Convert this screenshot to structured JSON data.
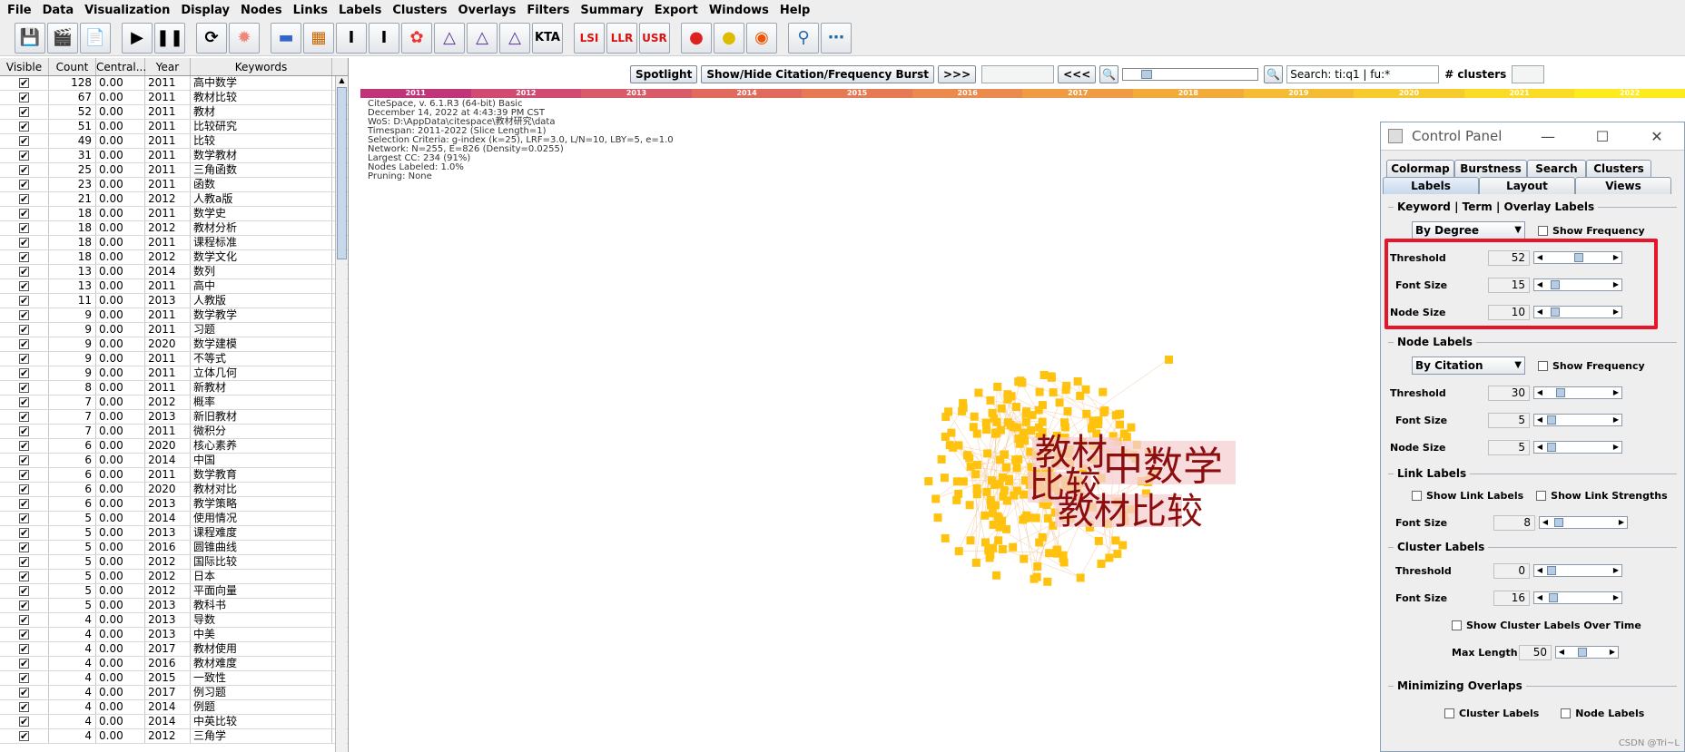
{
  "menu": [
    "File",
    "Data",
    "Visualization",
    "Display",
    "Nodes",
    "Links",
    "Labels",
    "Clusters",
    "Overlays",
    "Filters",
    "Summary",
    "Export",
    "Windows",
    "Help"
  ],
  "toolbar": {
    "lsi": "LSI",
    "llr": "LLR",
    "usr": "USR",
    "kta": "KTA"
  },
  "table": {
    "headers": [
      "Visible",
      "Count",
      "Central...",
      "Year",
      "Keywords"
    ],
    "rows": [
      [
        "128",
        "0.00",
        "2011",
        "高中数学"
      ],
      [
        "67",
        "0.00",
        "2011",
        "教材比较"
      ],
      [
        "52",
        "0.00",
        "2011",
        "教材"
      ],
      [
        "51",
        "0.00",
        "2011",
        "比较研究"
      ],
      [
        "49",
        "0.00",
        "2011",
        "比较"
      ],
      [
        "31",
        "0.00",
        "2011",
        "数学教材"
      ],
      [
        "25",
        "0.00",
        "2011",
        "三角函数"
      ],
      [
        "23",
        "0.00",
        "2011",
        "函数"
      ],
      [
        "21",
        "0.00",
        "2012",
        "人教a版"
      ],
      [
        "18",
        "0.00",
        "2011",
        "数学史"
      ],
      [
        "18",
        "0.00",
        "2012",
        "教材分析"
      ],
      [
        "18",
        "0.00",
        "2011",
        "课程标准"
      ],
      [
        "18",
        "0.00",
        "2012",
        "数学文化"
      ],
      [
        "13",
        "0.00",
        "2014",
        "数列"
      ],
      [
        "13",
        "0.00",
        "2011",
        "高中"
      ],
      [
        "11",
        "0.00",
        "2013",
        "人教版"
      ],
      [
        "9",
        "0.00",
        "2011",
        "数学教学"
      ],
      [
        "9",
        "0.00",
        "2011",
        "习题"
      ],
      [
        "9",
        "0.00",
        "2020",
        "数学建模"
      ],
      [
        "9",
        "0.00",
        "2011",
        "不等式"
      ],
      [
        "9",
        "0.00",
        "2011",
        "立体几何"
      ],
      [
        "8",
        "0.00",
        "2011",
        "新教材"
      ],
      [
        "7",
        "0.00",
        "2012",
        "概率"
      ],
      [
        "7",
        "0.00",
        "2013",
        "新旧教材"
      ],
      [
        "7",
        "0.00",
        "2011",
        "微积分"
      ],
      [
        "6",
        "0.00",
        "2020",
        "核心素养"
      ],
      [
        "6",
        "0.00",
        "2014",
        "中国"
      ],
      [
        "6",
        "0.00",
        "2011",
        "数学教育"
      ],
      [
        "6",
        "0.00",
        "2020",
        "教材对比"
      ],
      [
        "6",
        "0.00",
        "2013",
        "教学策略"
      ],
      [
        "5",
        "0.00",
        "2014",
        "使用情况"
      ],
      [
        "5",
        "0.00",
        "2013",
        "课程难度"
      ],
      [
        "5",
        "0.00",
        "2016",
        "圆锥曲线"
      ],
      [
        "5",
        "0.00",
        "2012",
        "国际比较"
      ],
      [
        "5",
        "0.00",
        "2012",
        "日本"
      ],
      [
        "5",
        "0.00",
        "2012",
        "平面向量"
      ],
      [
        "5",
        "0.00",
        "2013",
        "教科书"
      ],
      [
        "4",
        "0.00",
        "2013",
        "导数"
      ],
      [
        "4",
        "0.00",
        "2013",
        "中美"
      ],
      [
        "4",
        "0.00",
        "2017",
        "教材使用"
      ],
      [
        "4",
        "0.00",
        "2016",
        "教材难度"
      ],
      [
        "4",
        "0.00",
        "2015",
        "一致性"
      ],
      [
        "4",
        "0.00",
        "2017",
        "例习题"
      ],
      [
        "4",
        "0.00",
        "2014",
        "例题"
      ],
      [
        "4",
        "0.00",
        "2014",
        "中英比较"
      ],
      [
        "4",
        "0.00",
        "2012",
        "三角学"
      ]
    ]
  },
  "controls": {
    "spotlight": "Spotlight",
    "show_hide": "Show/Hide Citation/Frequency Burst",
    "next": ">>>",
    "prev": "<<<",
    "search_value": "Search: ti:q1 | fu:*",
    "clusters_label": "# clusters"
  },
  "timeline": {
    "years": [
      "2011",
      "2012",
      "2013",
      "2014",
      "2015",
      "2016",
      "2017",
      "2018",
      "2019",
      "2020",
      "2021",
      "2022"
    ],
    "colors": [
      "#c0357a",
      "#d04a72",
      "#d95b68",
      "#e06a5e",
      "#e57a55",
      "#ea8a4c",
      "#ee9b43",
      "#f2ab3b",
      "#f5bb33",
      "#f8cb2c",
      "#fbdb25",
      "#fdeb1f"
    ]
  },
  "info": [
    "CiteSpace, v. 6.1.R3 (64-bit) Basic",
    "December 14, 2022 at 4:43:39 PM CST",
    "WoS: D:\\AppData\\citespace\\教材研究\\data",
    "Timespan: 2011-2022 (Slice Length=1)",
    "Selection Criteria: g-index (k=25), LRF=3.0, L/N=10, LBY=5, e=1.0",
    "Network: N=255, E=826 (Density=0.0255)",
    "Largest CC: 234 (91%)",
    "Nodes Labeled: 1.0%",
    "Pruning: None"
  ],
  "graph": {
    "labels": [
      "教材",
      "中数学",
      "比较",
      "教材比较"
    ],
    "node_color": "#ffc20e",
    "label_color": "#8b0d0d"
  },
  "panel": {
    "title": "Control Panel",
    "tabs_row1": [
      "Colormap",
      "Burstness",
      "Search",
      "Clusters"
    ],
    "tabs_row2": [
      "Labels",
      "Layout",
      "Views"
    ],
    "keyword_group": "Keyword | Term | Overlay Labels",
    "keyword_combo": "By Degree",
    "show_frequency": "Show Frequency",
    "threshold": "Threshold",
    "font_size": "Font Size",
    "node_size": "Node Size",
    "kw_threshold": "52",
    "kw_font": "15",
    "kw_node": "10",
    "node_group": "Node Labels",
    "node_combo": "By Citation",
    "nl_threshold": "30",
    "nl_font": "5",
    "nl_node": "5",
    "link_group": "Link Labels",
    "show_link_labels": "Show Link Labels",
    "show_link_strengths": "Show Link Strengths",
    "ll_font": "8",
    "cluster_group": "Cluster Labels",
    "cl_threshold": "0",
    "cl_font": "16",
    "show_cluster_time": "Show Cluster Labels Over Time",
    "max_length": "Max Length",
    "cl_max": "50",
    "min_group": "Minimizing Overlaps",
    "min_cluster": "Cluster Labels",
    "min_node": "Node Labels"
  },
  "watermark": "CSDN @Tri~L"
}
